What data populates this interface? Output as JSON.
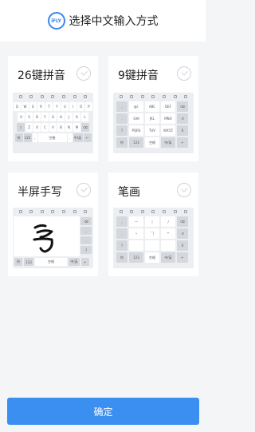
{
  "header": {
    "logo_text": "iFLY",
    "title": "选择中文输入方式"
  },
  "options": [
    {
      "label": "26键拼音"
    },
    {
      "label": "9键拼音"
    },
    {
      "label": "半屏手写"
    },
    {
      "label": "笔画"
    }
  ],
  "keyboards": {
    "qwerty_row1": [
      "Q",
      "W",
      "E",
      "R",
      "T",
      "Y",
      "U",
      "I",
      "O",
      "P"
    ],
    "qwerty_row2": [
      "A",
      "S",
      "D",
      "F",
      "G",
      "H",
      "J",
      "K",
      "L"
    ],
    "qwerty_row3": [
      "Z",
      "X",
      "C",
      "V",
      "B",
      "N",
      "M"
    ],
    "nine_keys": [
      "@/.",
      "ABC",
      "DEF",
      "GHI",
      "JKL",
      "MNO",
      "PQRS",
      "TUV",
      "WXYZ"
    ],
    "stroke_keys": [
      "一",
      "丨",
      "丿",
      "丶",
      "𠃍",
      "*"
    ],
    "handwriting_glyph": "写",
    "space_label": "空格",
    "bottom_keys": [
      "符",
      "123",
      "中/英"
    ]
  },
  "footer": {
    "confirm_label": "确定"
  },
  "colors": {
    "accent": "#3b8ff0",
    "background": "#f4f5f7"
  }
}
